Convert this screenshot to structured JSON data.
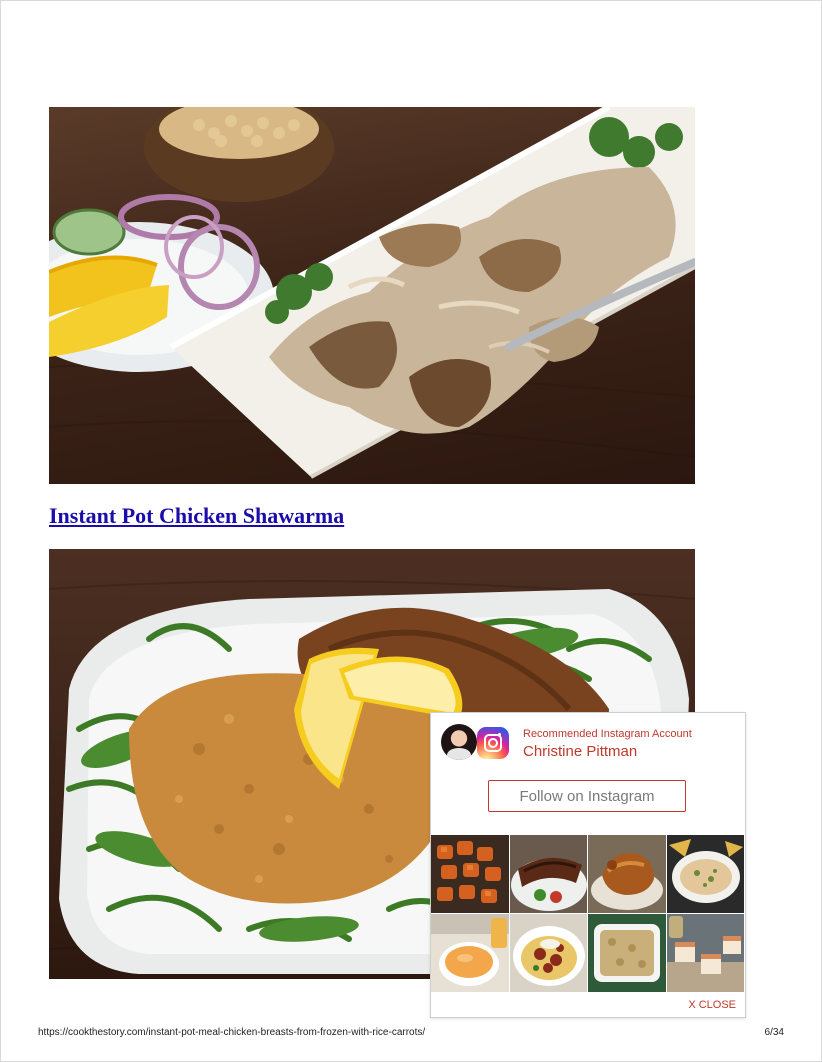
{
  "recipe": {
    "link_label": "Instant Pot Chicken Shawarma",
    "image1_subject": "shawarma-photo",
    "image2_subject": "schnitzel-photo"
  },
  "instagram_widget": {
    "recommended_label": "Recommended Instagram Account",
    "account_name": "Christine Pittman",
    "follow_label": "Follow on Instagram",
    "close_label": "X CLOSE",
    "accent_color": "#c0392b",
    "thumbnails": [
      "roasted-sweet-potatoes",
      "grilled-ribs",
      "roast-chicken",
      "spinach-dip",
      "cheese-sauce",
      "pasta-bolognese",
      "casserole",
      "cheesecake-bars"
    ]
  },
  "footer": {
    "url": "https://cookthestory.com/instant-pot-meal-chicken-breasts-from-frozen-with-rice-carrots/",
    "page": "6/34"
  }
}
